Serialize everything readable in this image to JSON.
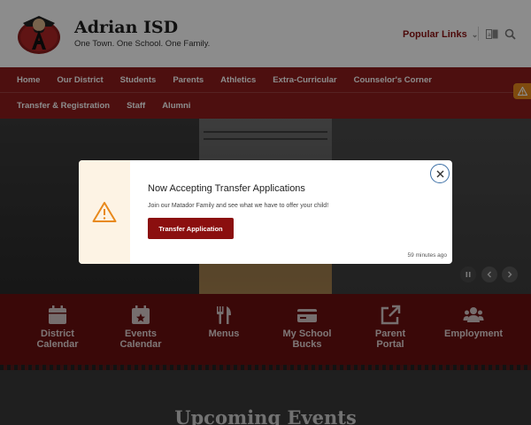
{
  "header": {
    "title": "Adrian ISD",
    "tagline": "One Town. One School. One Family.",
    "popular_links_label": "Popular Links"
  },
  "nav": {
    "row1": [
      "Home",
      "Our District",
      "Students",
      "Parents",
      "Athletics",
      "Extra-Curricular",
      "Counselor's Corner"
    ],
    "row2": [
      "Transfer & Registration",
      "Staff",
      "Alumni"
    ]
  },
  "quick_links": [
    {
      "label": "District Calendar",
      "icon": "calendar-icon"
    },
    {
      "label": "Events Calendar",
      "icon": "star-calendar-icon"
    },
    {
      "label": "Menus",
      "icon": "utensils-icon"
    },
    {
      "label": "My School Bucks",
      "icon": "card-icon"
    },
    {
      "label": "Parent Portal",
      "icon": "external-link-icon"
    },
    {
      "label": "Employment",
      "icon": "users-icon"
    }
  ],
  "events": {
    "title": "Upcoming Events"
  },
  "modal": {
    "title": "Now Accepting Transfer Applications",
    "text": "Join our Matador Family and see what we have to offer your child!",
    "button_label": "Transfer Application",
    "timestamp": "59 minutes ago"
  },
  "colors": {
    "brand_red": "#8c1d1d",
    "quick_links_bg": "#6a1010",
    "alert_orange": "#e8891c",
    "button_red": "#8b0f0f"
  }
}
